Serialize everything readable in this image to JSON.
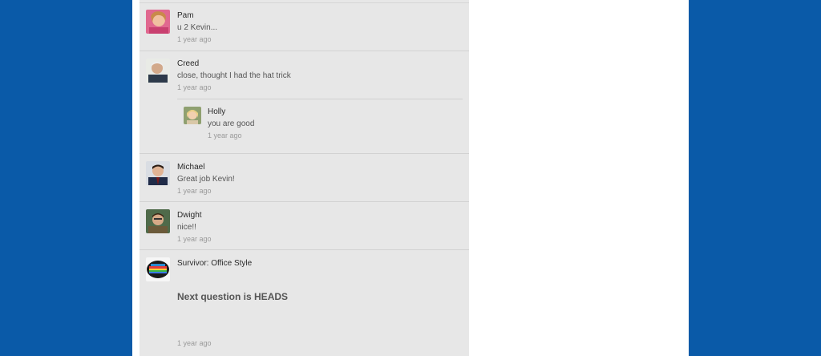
{
  "comments": [
    {
      "author": "Pam",
      "text": "u 2 Kevin...",
      "time": "1 year ago"
    },
    {
      "author": "Creed",
      "text": "close, thought I had the hat trick",
      "time": "1 year ago",
      "reply": {
        "author": "Holly",
        "text": "you are good",
        "time": "1 year ago"
      }
    },
    {
      "author": "Michael",
      "text": "Great job Kevin!",
      "time": "1 year ago"
    },
    {
      "author": "Dwight",
      "text": "nice!!",
      "time": "1 year ago"
    },
    {
      "author": "Survivor: Office Style",
      "headline": "Next question is HEADS",
      "time": "1 year ago"
    }
  ],
  "colors": {
    "background": "#0a5aa8",
    "feed": "#e7e7e7"
  }
}
